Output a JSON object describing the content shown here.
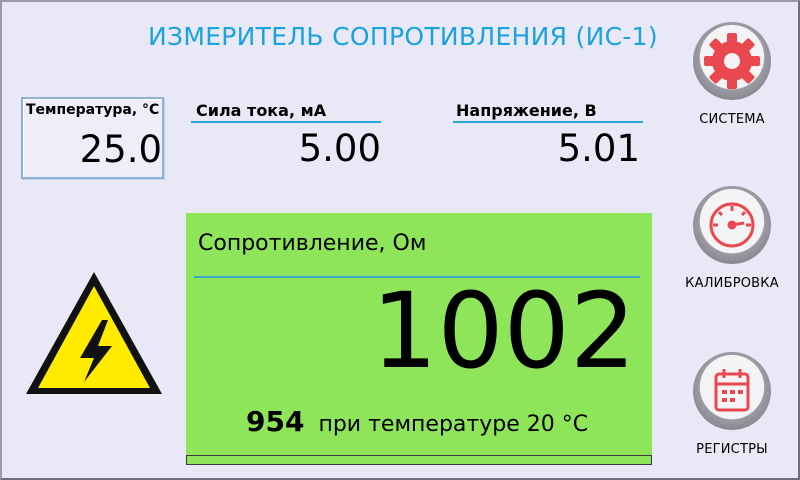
{
  "title": "ИЗМЕРИТЕЛЬ СОПРОТИВЛЕНИЯ (ИС-1)",
  "temperature": {
    "label": "Температура, °C",
    "value": "25.0"
  },
  "current": {
    "label": "Сила тока, мА",
    "value": "5.00"
  },
  "voltage": {
    "label": "Напряжение, В",
    "value": "5.01"
  },
  "resistance": {
    "label": "Сопротивление, Ом",
    "value": "1002",
    "corrected_value": "954",
    "corrected_label": "при температуре 20 °C"
  },
  "progress": {
    "fraction": 1.0
  },
  "buttons": {
    "system": {
      "label": "СИСТЕМА",
      "icon": "gear-icon"
    },
    "calibration": {
      "label": "КАЛИБРОВКА",
      "icon": "gauge-icon"
    },
    "registers": {
      "label": "РЕГИСТРЫ",
      "icon": "clipboard-icon"
    }
  },
  "colors": {
    "title": "#1ba3de",
    "panel_green": "#8ee55a",
    "icon_red": "#e9484f",
    "warning_yellow": "#ffea00"
  }
}
